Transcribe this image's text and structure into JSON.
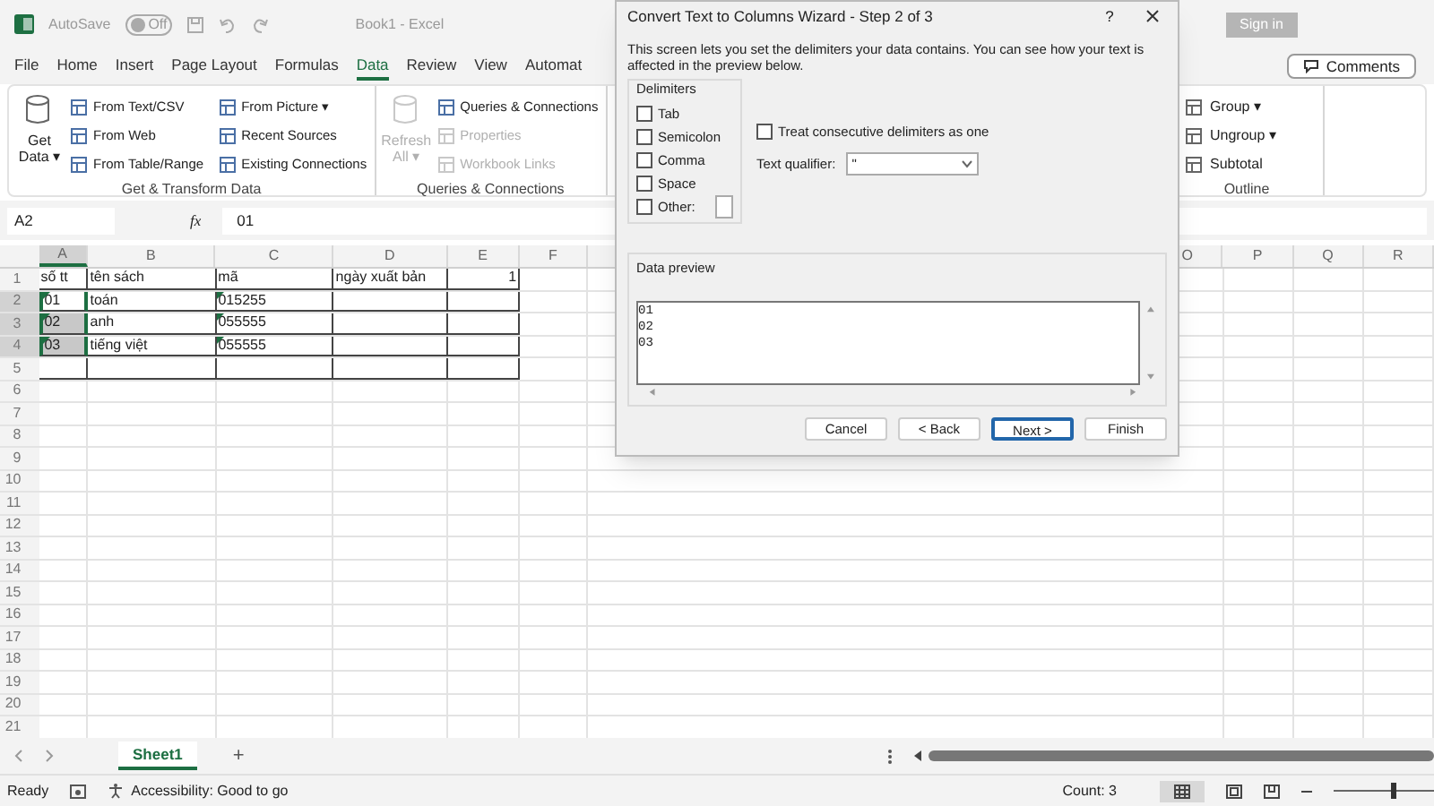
{
  "title_bar": {
    "autosave_label": "AutoSave",
    "autosave": {
      "on": false,
      "label": "Off"
    },
    "document_title": "Book1 - Excel",
    "sign_in": "Sign in"
  },
  "ribbon_tabs": [
    {
      "label": "File",
      "selected": false
    },
    {
      "label": "Home",
      "selected": false
    },
    {
      "label": "Insert",
      "selected": false
    },
    {
      "label": "Page Layout",
      "selected": false
    },
    {
      "label": "Formulas",
      "selected": false
    },
    {
      "label": "Data",
      "selected": true
    },
    {
      "label": "Review",
      "selected": false
    },
    {
      "label": "View",
      "selected": false
    },
    {
      "label": "Automat",
      "selected": false
    }
  ],
  "comments_button": "Comments",
  "ribbon_groups": [
    {
      "name": "Get & Transform Data",
      "big": {
        "label": "Get Data",
        "caret": "▾",
        "disabled": false
      },
      "items": [
        {
          "label": "From Text/CSV",
          "disabled": false
        },
        {
          "label": "From Web",
          "disabled": false
        },
        {
          "label": "From Table/Range",
          "disabled": false
        },
        {
          "label": "From Picture ▾",
          "disabled": false
        },
        {
          "label": "Recent Sources",
          "disabled": false
        },
        {
          "label": "Existing Connections",
          "disabled": false
        }
      ]
    },
    {
      "name": "Queries & Connections",
      "big": {
        "label": "Refresh All",
        "caret": "▾",
        "disabled": true
      },
      "items": [
        {
          "label": "Queries & Connections",
          "disabled": false
        },
        {
          "label": "Properties",
          "disabled": true
        },
        {
          "label": "Workbook Links",
          "disabled": true
        }
      ]
    }
  ],
  "outline_group": {
    "name": "Outline",
    "items": [
      {
        "label": "Group ▾"
      },
      {
        "label": "Ungroup ▾"
      },
      {
        "label": "Subtotal"
      }
    ]
  },
  "formula_bar": {
    "name_box": "A2",
    "fx": "fx",
    "value": "01"
  },
  "columns": [
    {
      "letter": "A",
      "selected": true
    },
    {
      "letter": "B",
      "selected": false
    },
    {
      "letter": "C",
      "selected": false
    },
    {
      "letter": "D",
      "selected": false
    },
    {
      "letter": "E",
      "selected": false
    },
    {
      "letter": "F",
      "selected": false
    },
    {
      "letter": "O",
      "selected": false
    },
    {
      "letter": "P",
      "selected": false
    },
    {
      "letter": "Q",
      "selected": false
    },
    {
      "letter": "R",
      "selected": false
    }
  ],
  "rows": [
    {
      "number": "1",
      "selected": false,
      "cells": [
        {
          "text": "số tt",
          "selected": false,
          "flag": false
        },
        {
          "text": "tên sách",
          "selected": false,
          "flag": false
        },
        {
          "text": "mã",
          "selected": false,
          "flag": false
        },
        {
          "text": "ngày xuất bản",
          "selected": false,
          "flag": false
        },
        {
          "text": "1",
          "selected": false,
          "flag": false
        }
      ]
    },
    {
      "number": "2",
      "selected": true,
      "cells": [
        {
          "text": "01",
          "selected": true,
          "active": true,
          "flag": true
        },
        {
          "text": "toán",
          "selected": false,
          "flag": false
        },
        {
          "text": "015255",
          "selected": false,
          "flag": true
        },
        {
          "selected": false,
          "flag": false
        },
        {
          "selected": false,
          "flag": false
        }
      ]
    },
    {
      "number": "3",
      "selected": true,
      "cells": [
        {
          "text": "02",
          "selected": true,
          "flag": true
        },
        {
          "text": "anh",
          "selected": false,
          "flag": false
        },
        {
          "text": "055555",
          "selected": false,
          "flag": true
        },
        {
          "selected": false,
          "flag": false
        },
        {
          "selected": false,
          "flag": false
        }
      ]
    },
    {
      "number": "4",
      "selected": true,
      "cells": [
        {
          "text": "03",
          "selected": true,
          "flag": true
        },
        {
          "text": "tiếng việt",
          "selected": false,
          "flag": false
        },
        {
          "text": "055555",
          "selected": false,
          "flag": true
        },
        {
          "selected": false,
          "flag": false
        },
        {
          "selected": false,
          "flag": false
        }
      ]
    },
    {
      "number": "5",
      "selected": false,
      "cells": [
        {
          "selected": false,
          "flag": false
        },
        {
          "selected": false,
          "flag": false
        },
        {
          "selected": false,
          "flag": false
        },
        {
          "selected": false,
          "flag": false
        },
        {
          "selected": false,
          "flag": false
        }
      ]
    },
    {
      "number": "6",
      "selected": false,
      "cells": []
    },
    {
      "number": "7",
      "selected": false,
      "cells": []
    },
    {
      "number": "8",
      "selected": false,
      "cells": []
    },
    {
      "number": "9",
      "selected": false,
      "cells": []
    },
    {
      "number": "10",
      "selected": false,
      "cells": []
    },
    {
      "number": "11",
      "selected": false,
      "cells": []
    },
    {
      "number": "12",
      "selected": false,
      "cells": []
    },
    {
      "number": "13",
      "selected": false,
      "cells": []
    },
    {
      "number": "14",
      "selected": false,
      "cells": []
    },
    {
      "number": "15",
      "selected": false,
      "cells": []
    },
    {
      "number": "16",
      "selected": false,
      "cells": []
    },
    {
      "number": "17",
      "selected": false,
      "cells": []
    },
    {
      "number": "18",
      "selected": false,
      "cells": []
    },
    {
      "number": "19",
      "selected": false,
      "cells": []
    },
    {
      "number": "20",
      "selected": false,
      "cells": []
    },
    {
      "number": "21",
      "selected": false,
      "cells": []
    }
  ],
  "sheet_tabs": [
    {
      "label": "Sheet1",
      "selected": true
    }
  ],
  "add_sheet": "+",
  "status_bar": {
    "mode": "Ready",
    "accessibility": "Accessibility: Good to go",
    "count": "Count: 3",
    "zoom": {
      "level": 0.55
    }
  },
  "dialog": {
    "title": "Convert Text to Columns Wizard - Step 2 of 3",
    "help": "?",
    "description": "This screen lets you set the delimiters your data contains.  You can see how your text is affected in the preview below.",
    "delimiters_title": "Delimiters",
    "delimiters": [
      {
        "label": "Tab",
        "checked": false
      },
      {
        "label": "Semicolon",
        "checked": false
      },
      {
        "label": "Comma",
        "checked": false
      },
      {
        "label": "Space",
        "checked": false
      },
      {
        "label": "Other:",
        "checked": false,
        "kind": "other"
      }
    ],
    "consecutive": {
      "label": "Treat consecutive delimiters as one",
      "checked": false
    },
    "qualifier": {
      "label": "Text qualifier:",
      "value": "\""
    },
    "preview_title": "Data preview",
    "preview_lines": [
      "01",
      "02",
      "03"
    ],
    "buttons": [
      {
        "label": "Cancel",
        "default": false
      },
      {
        "label": "< Back",
        "default": false
      },
      {
        "label": "Next >",
        "default": true
      },
      {
        "label": "Finish",
        "default": false
      }
    ]
  }
}
